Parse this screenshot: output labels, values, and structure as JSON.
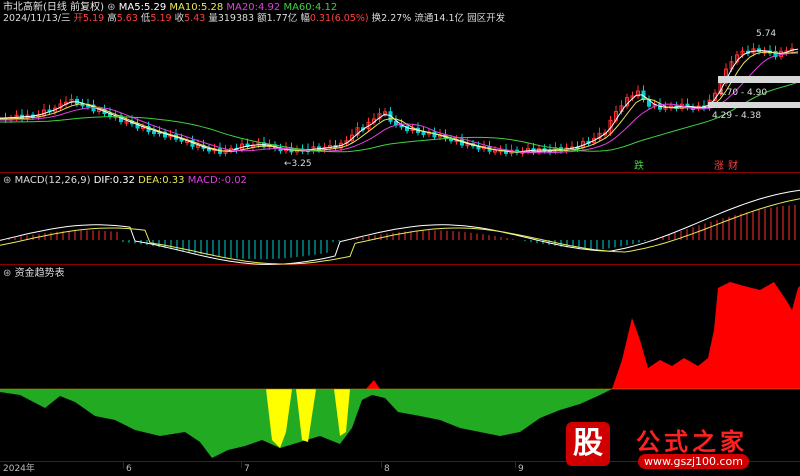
{
  "main_panel": {
    "title": "市北高新(日线 前复权)",
    "ma": [
      {
        "label": "MA5:",
        "value": "5.29",
        "color": "#ffffff"
      },
      {
        "label": "MA10:",
        "value": "5.28",
        "color": "#e8e85a"
      },
      {
        "label": "MA20:",
        "value": "4.92",
        "color": "#e040e0"
      },
      {
        "label": "MA60:",
        "value": "4.12",
        "color": "#3fd13f"
      }
    ],
    "info": {
      "date": "2024/11/13/三",
      "open_label": "开",
      "open": "5.19",
      "high_label": "高",
      "high": "5.63",
      "low_label": "低",
      "low": "5.19",
      "close_label": "收",
      "close": "5.43",
      "vol_label": "量",
      "vol": "319383",
      "amt_label": "额",
      "amt": "1.77亿",
      "chg_label": "幅",
      "chg": "0.31(6.05%)",
      "turnover_label": "换",
      "turnover": "2.27%",
      "float_label": "流通",
      "float": "14.1亿",
      "sector": "园区开发"
    },
    "price_labels": {
      "high_mark": "5.74",
      "low_mark": "←3.25",
      "box1": "4.70 - 4.90",
      "box2": "4.29 - 4.38"
    },
    "signals": {
      "die": "跌",
      "zhang": "涨",
      "cai": "财"
    }
  },
  "macd_panel": {
    "title": "MACD(12,26,9)",
    "dif_label": "DIF:",
    "dif": "0.32",
    "dea_label": "DEA:",
    "dea": "0.33",
    "macd_label": "MACD:",
    "macd": "-0.02"
  },
  "fund_panel": {
    "title": "资金趋势表"
  },
  "x_axis": [
    "2024年",
    "6",
    "7",
    "8",
    "9"
  ],
  "watermark": {
    "logo": "股",
    "name": "公式之家",
    "url": "www.gszj100.com"
  },
  "colors": {
    "up": "#ff3030",
    "down": "#00d0d0",
    "fund_red": "#ff0000",
    "fund_green": "#22aa22",
    "fund_yellow": "#ffff00"
  }
}
